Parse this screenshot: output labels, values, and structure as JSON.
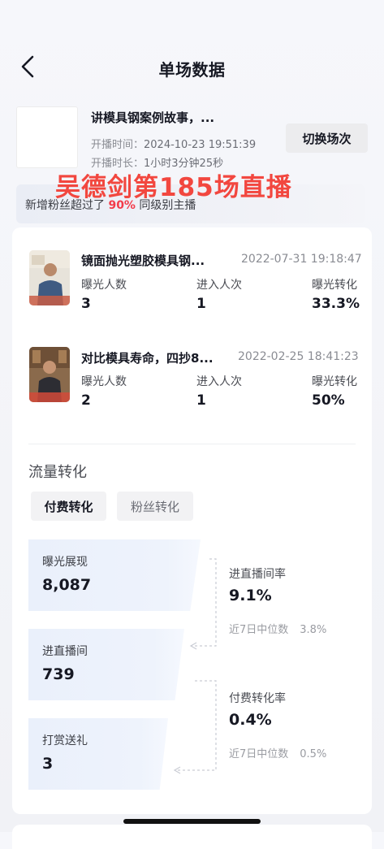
{
  "header": {
    "title": "单场数据"
  },
  "live": {
    "title": "讲模具钢案例故事，...",
    "start_label": "开播时间：",
    "start_value": "2024-10-23 19:51:39",
    "duration_label": "开播时长：",
    "duration_value": "1小时3分钟25秒",
    "switch_label": "切换场次"
  },
  "overlay_caption": "吴德剑第185场直播",
  "fans": {
    "prefix": "新增粉丝超过了",
    "percent": "90%",
    "suffix": "同级别主播"
  },
  "videos": [
    {
      "title": "镜面抛光塑胶模具钢...",
      "date": "2022-07-31 19:18:47",
      "stats": [
        {
          "label": "曝光人数",
          "value": "3"
        },
        {
          "label": "进入人次",
          "value": "1"
        },
        {
          "label": "曝光转化",
          "value": "33.3%"
        }
      ]
    },
    {
      "title": "对比模具寿命，四抄8...",
      "date": "2022-02-25 18:41:23",
      "stats": [
        {
          "label": "曝光人数",
          "value": "2"
        },
        {
          "label": "进入人次",
          "value": "1"
        },
        {
          "label": "曝光转化",
          "value": "50%"
        }
      ]
    }
  ],
  "traffic": {
    "section_title": "流量转化",
    "tabs": [
      {
        "label": "付费转化",
        "active": true
      },
      {
        "label": "粉丝转化",
        "active": false
      }
    ],
    "funnel": [
      {
        "label": "曝光展现",
        "value": "8,087"
      },
      {
        "label": "进直播间",
        "value": "739"
      },
      {
        "label": "打赏送礼",
        "value": "3"
      }
    ],
    "rates": [
      {
        "label": "进直播间率",
        "value": "9.1%",
        "median_label": "近7日中位数",
        "median_value": "3.8%"
      },
      {
        "label": "付费转化率",
        "value": "0.4%",
        "median_label": "近7日中位数",
        "median_value": "0.5%"
      }
    ]
  },
  "colors": {
    "accent_red": "#f33b4a",
    "caption_red": "#f2473f",
    "funnel_blue": "#eaf0fb"
  },
  "icons": {
    "back": "chevron-left-icon"
  }
}
